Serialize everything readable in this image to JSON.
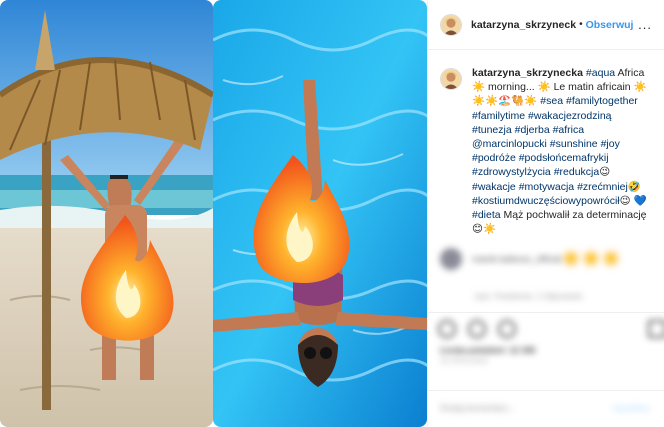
{
  "post": {
    "username": "katarzyna_skrzyneck",
    "header_separator": "•",
    "follow_label": "Obserwuj",
    "more_label": "...",
    "caption_username": "katarzyna_skrzynecka",
    "caption_html": "<a>#aqua</a> Africa ☀️ morning... ☀️ Le matin africain ☀️☀️☀️🏖️🐫☀️ <a>#sea</a> <a>#familytogether</a> <a>#familytime</a> <a>#wakacjezrodziną</a> <a>#tunezja</a> <a>#djerba</a> <a>#africa</a> <a>@marcinlopucki</a> <a>#sunshine</a> <a>#joy</a> <a>#podróże</a> <a>#podsłońcemafrykij</a> <a>#zdrowystylżycia</a> <a>#redukcja</a>😉 <a>#wakacje</a> <a>#motywacja</a> <a>#zrećmniej</a>🤣 <a>#kostiumdwuczęściowypowrócił</a>😉 💙 <a>#dieta</a> Mąż pochwalił za determinację 😊☀️"
  },
  "blurred": {
    "comment_text": "marek.tadeusz_official",
    "comment_emoji": "☀️☀️☀️",
    "meta_text": "tydz.   Polubienia: 1   Odpowiedz",
    "likes_text": "Liczba polubień: 12 345",
    "date_text": "10 LIPCA 2019",
    "add_comment": "Dodaj komentarz...",
    "post_label": "Opublikuj"
  },
  "icons": {
    "header_avatar": "profile-avatar-icon",
    "caption_avatar": "profile-avatar-icon",
    "flame": "fire-emoji-icon"
  },
  "colors": {
    "link": "#003569",
    "follow": "#3897f0",
    "border": "#efefef"
  }
}
